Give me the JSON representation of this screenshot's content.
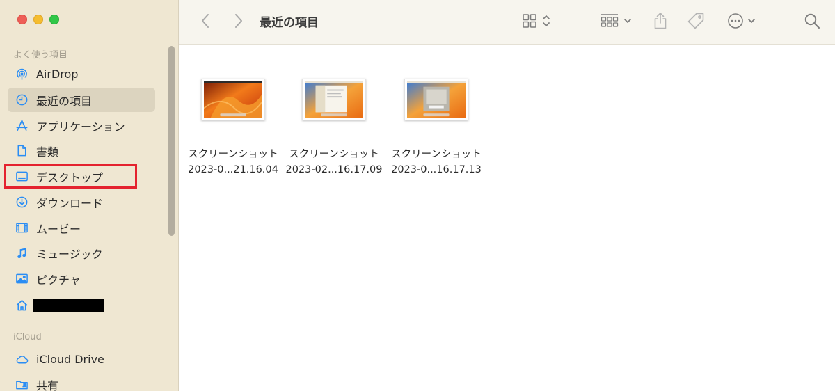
{
  "sidebar": {
    "favorites_header": "よく使う項目",
    "items": [
      {
        "label": "AirDrop",
        "icon": "airdrop-icon"
      },
      {
        "label": "最近の項目",
        "icon": "clock-icon"
      },
      {
        "label": "アプリケーション",
        "icon": "applications-icon"
      },
      {
        "label": "書類",
        "icon": "document-icon"
      },
      {
        "label": "デスクトップ",
        "icon": "desktop-icon"
      },
      {
        "label": "ダウンロード",
        "icon": "download-icon"
      },
      {
        "label": "ムービー",
        "icon": "film-icon"
      },
      {
        "label": "ミュージック",
        "icon": "music-note-icon"
      },
      {
        "label": "ピクチャ",
        "icon": "photo-icon"
      },
      {
        "label": "",
        "icon": "home-icon"
      }
    ],
    "icloud_header": "iCloud",
    "icloud_items": [
      {
        "label": "iCloud Drive",
        "icon": "cloud-icon"
      },
      {
        "label": "共有",
        "icon": "shared-folder-icon"
      }
    ]
  },
  "toolbar": {
    "title": "最近の項目"
  },
  "files": [
    {
      "line1": "スクリーンショット",
      "line2": "2023-0...21.16.04"
    },
    {
      "line1": "スクリーンショット",
      "line2": "2023-02...16.17.09"
    },
    {
      "line1": "スクリーンショット",
      "line2": "2023-0...16.17.13"
    }
  ],
  "colors": {
    "accent_icon": "#2a8df4",
    "sidebar_bg": "#efe7d2",
    "highlight": "#e4232f"
  }
}
